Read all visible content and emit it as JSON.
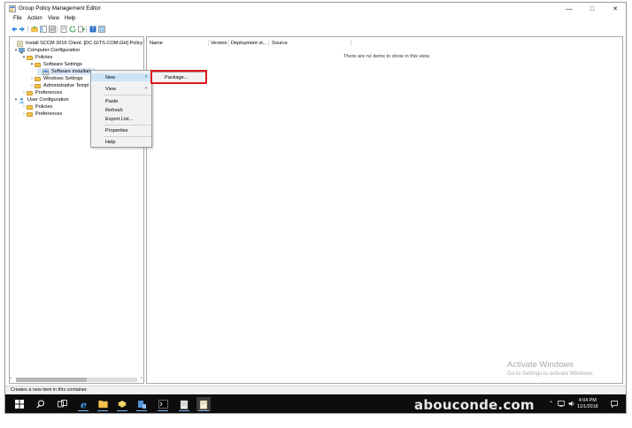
{
  "window": {
    "title": "Group Policy Management Editor",
    "controls": {
      "minimize": "—",
      "maximize": "□",
      "close": "✕"
    }
  },
  "menubar": {
    "items": [
      "File",
      "Action",
      "View",
      "Help"
    ]
  },
  "toolbar": {
    "icons": [
      "back-arrow-icon",
      "forward-arrow-icon",
      "up-folder-icon",
      "show-hide-tree-icon",
      "properties-icon",
      "refresh-icon",
      "export-list-icon",
      "help-icon",
      "console-view-icon"
    ]
  },
  "tree": {
    "root": "Install SCCM 2016 Client. [DC.GITS.COM.GH] Policy",
    "computer_configuration": "Computer Configuration",
    "policies": "Policies",
    "software_settings": "Software Settings",
    "software_installation": "Software installation",
    "windows_settings": "Windows Settings",
    "administrative_templates": "Administrative Templ",
    "preferences": "Preferences",
    "user_configuration": "User Configuration",
    "user_policies": "Policies",
    "user_preferences": "Preferences"
  },
  "list": {
    "columns": [
      "Name",
      "Version",
      "Deployment st...",
      "Source"
    ],
    "empty_message": "There are no items to show in this view."
  },
  "context_menu": {
    "new": "New",
    "view": "View",
    "paste": "Paste",
    "refresh": "Refresh",
    "export_list": "Export List...",
    "properties": "Properties",
    "help": "Help",
    "arrow": "›"
  },
  "submenu": {
    "package": "Package..."
  },
  "status_bar": {
    "text": "Creates a new item in this container."
  },
  "activation": {
    "line1": "Activate Windows",
    "line2": "Go to Settings to activate Windows."
  },
  "watermark": "abouconde.com",
  "taskbar": {
    "time": "4:04 PM",
    "date": "11/1/2018",
    "icons": [
      "windows-start-icon",
      "search-icon",
      "task-view-icon",
      "edge-icon",
      "file-explorer-icon",
      "server-manager-icon",
      "network-icon",
      "cmd-icon",
      "notepad-icon",
      "gpme-icon"
    ]
  },
  "colors": {
    "accent_red": "#e0161b",
    "menu_highlight": "#cce4f7",
    "taskbar_bg": "#0d0d0d",
    "folder": "#f1c24e"
  }
}
